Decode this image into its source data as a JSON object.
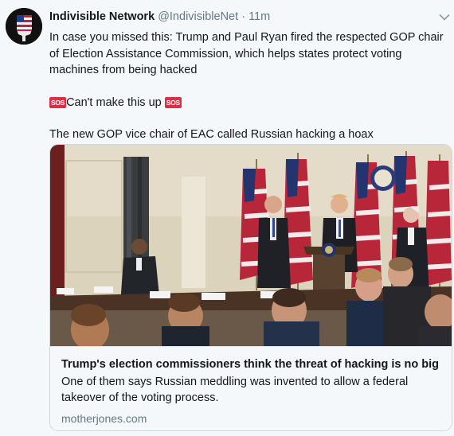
{
  "tweet": {
    "name": "Indivisible Network",
    "handle": "@IndivisibleNet",
    "dot": "·",
    "time": "11m",
    "text_1": "In case you missed this: Trump and Paul Ryan fired the respected GOP chair of Election Assistance Commission, which helps states protect voting machines from being hacked",
    "sos_label": "SOS",
    "text_2": "Can't make this up",
    "text_3": "The new GOP vice chair of EAC called Russian hacking a hoax",
    "menu_icon": "chevron-down-icon"
  },
  "card": {
    "title": "Trump's election commissioners think the threat of hacking is no big ...",
    "description": "One of them says Russian meddling was invented to allow a federal takeover of the voting process.",
    "domain": "motherjones.com"
  },
  "colors": {
    "background": "#f5f8fa",
    "text": "#14171a",
    "muted": "#657786",
    "sos_badge": "#dd2e44",
    "border": "#ccd6dd"
  }
}
